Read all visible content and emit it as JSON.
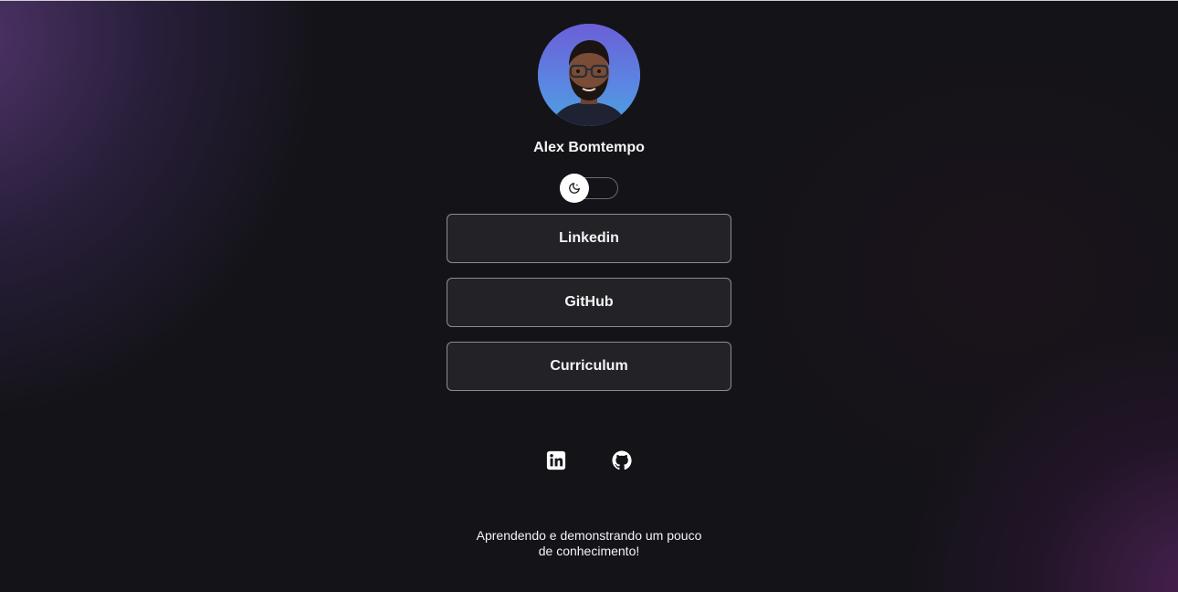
{
  "profile": {
    "name": "Alex Bomtempo"
  },
  "theme_toggle": {
    "icon": "moon-icon",
    "state": "dark"
  },
  "links": [
    {
      "label": "Linkedin"
    },
    {
      "label": "GitHub"
    },
    {
      "label": "Curriculum"
    }
  ],
  "social": {
    "icons": [
      "linkedin-icon",
      "github-icon"
    ]
  },
  "footer": {
    "line1": "Aprendendo e demonstrando um pouco",
    "line2": "de conhecimento!"
  },
  "colors": {
    "background": "#141318",
    "accent_purple": "#5a3a78",
    "button_border": "#8d8c94",
    "text": "#f4f4f5"
  }
}
